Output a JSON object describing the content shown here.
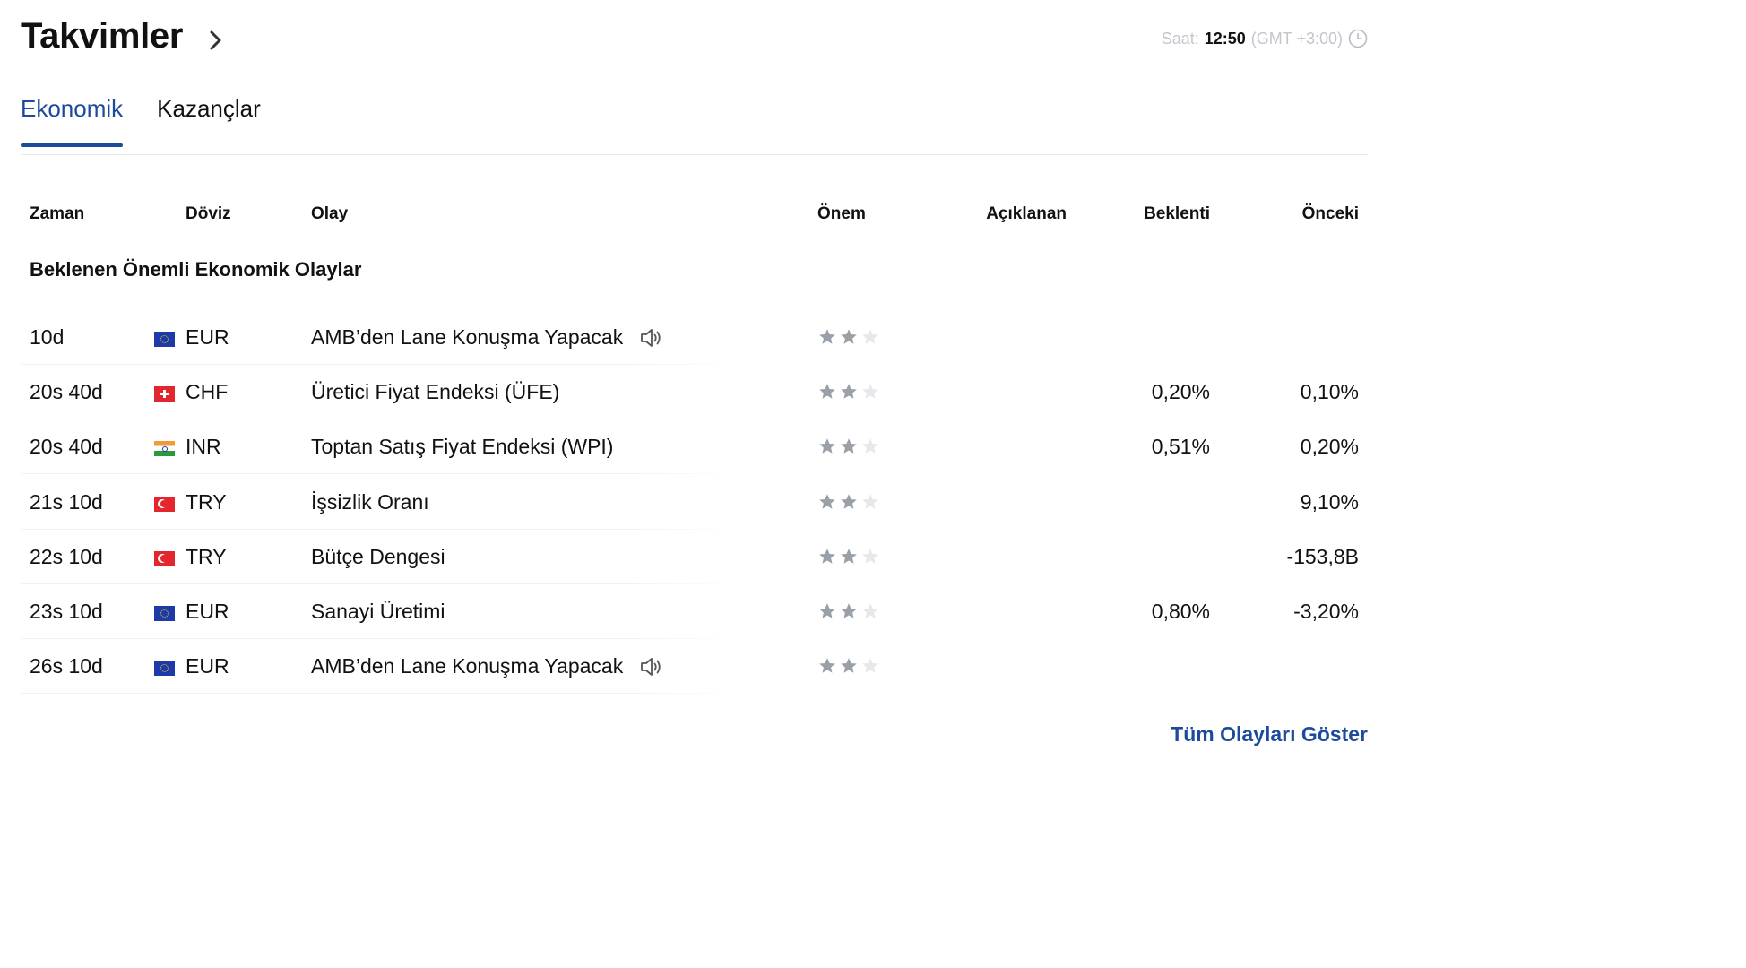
{
  "header": {
    "title": "Takvimler",
    "clock_label": "Saat:",
    "clock_time": "12:50",
    "clock_tz": "(GMT +3:00)"
  },
  "tabs": [
    {
      "label": "Ekonomik",
      "active": true
    },
    {
      "label": "Kazançlar",
      "active": false
    }
  ],
  "columns": {
    "zaman": "Zaman",
    "doviz": "Döviz",
    "olay": "Olay",
    "onem": "Önem",
    "aciklanan": "Açıklanan",
    "beklenti": "Beklenti",
    "onceki": "Önceki"
  },
  "section_title": "Beklenen Önemli Ekonomik Olaylar",
  "rows": [
    {
      "time": "10d",
      "flag": "eu-flag-icon",
      "currency": "EUR",
      "event": "AMB’den Lane Konuşma Yapacak",
      "speech": true,
      "stars": 2,
      "actual": "",
      "forecast": "",
      "previous": ""
    },
    {
      "time": "20s 40d",
      "flag": "ch-flag-icon",
      "currency": "CHF",
      "event": "Üretici Fiyat Endeksi (ÜFE)",
      "speech": false,
      "stars": 2,
      "actual": "",
      "forecast": "0,20%",
      "previous": "0,10%"
    },
    {
      "time": "20s 40d",
      "flag": "in-flag-icon",
      "currency": "INR",
      "event": "Toptan Satış Fiyat Endeksi (WPI)",
      "speech": false,
      "stars": 2,
      "actual": "",
      "forecast": "0,51%",
      "previous": "0,20%"
    },
    {
      "time": "21s 10d",
      "flag": "tr-flag-icon",
      "currency": "TRY",
      "event": "İşsizlik Oranı",
      "speech": false,
      "stars": 2,
      "actual": "",
      "forecast": "",
      "previous": "9,10%"
    },
    {
      "time": "22s 10d",
      "flag": "tr-flag-icon",
      "currency": "TRY",
      "event": "Bütçe Dengesi",
      "speech": false,
      "stars": 2,
      "actual": "",
      "forecast": "",
      "previous": "-153,8B"
    },
    {
      "time": "23s 10d",
      "flag": "eu-flag-icon",
      "currency": "EUR",
      "event": "Sanayi Üretimi",
      "speech": false,
      "stars": 2,
      "actual": "",
      "forecast": "0,80%",
      "previous": "-3,20%"
    },
    {
      "time": "26s 10d",
      "flag": "eu-flag-icon",
      "currency": "EUR",
      "event": "AMB’den Lane Konuşma Yapacak",
      "speech": true,
      "stars": 2,
      "actual": "",
      "forecast": "",
      "previous": ""
    }
  ],
  "footer": {
    "show_all": "Tüm Olayları Göster"
  },
  "colors": {
    "accent": "#1c4b9c",
    "star_filled": "#9aa0a8",
    "star_empty": "#e6e8eb",
    "muted": "#c3c6cc"
  }
}
